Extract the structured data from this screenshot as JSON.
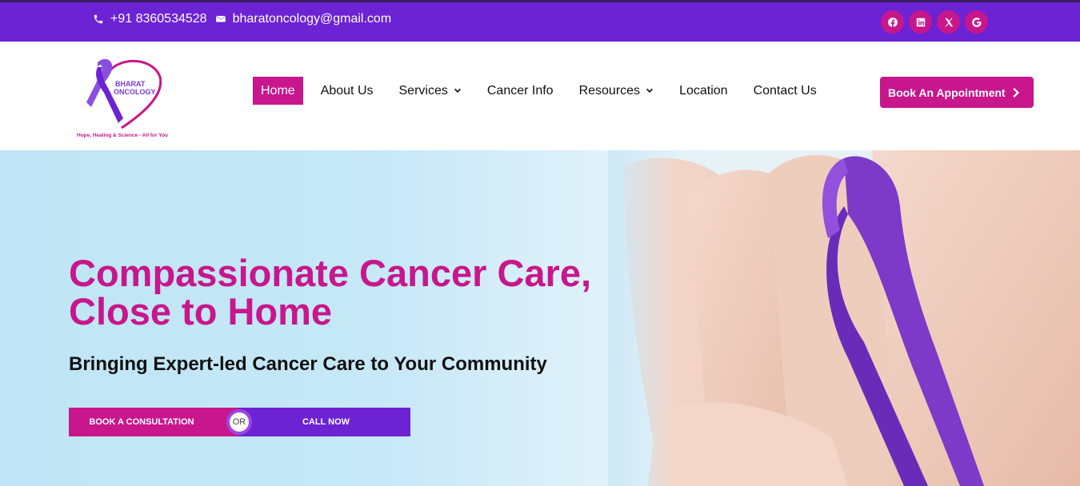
{
  "topbar": {
    "phone": "+91 8360534528",
    "email": "bharatoncology@gmail.com",
    "socials": [
      "facebook-icon",
      "linkedin-icon",
      "x-icon",
      "google-icon"
    ]
  },
  "logo": {
    "line1": "BHARAT",
    "line2": "ONCOLOGY",
    "tagline": "Hope, Healing & Science - All for You"
  },
  "nav": {
    "items": [
      {
        "label": "Home",
        "active": true
      },
      {
        "label": "About Us"
      },
      {
        "label": "Services",
        "dropdown": true
      },
      {
        "label": "Cancer Info"
      },
      {
        "label": "Resources",
        "dropdown": true
      },
      {
        "label": "Location"
      },
      {
        "label": "Contact Us"
      }
    ]
  },
  "header": {
    "book_label": "Book An Appointment"
  },
  "hero": {
    "title_line1": "Compassionate Cancer Care,",
    "title_line2": "Close to Home",
    "subtitle": "Bringing Expert-led Cancer Care to Your Community",
    "cta_left": "BOOK A CONSULTATION",
    "cta_or": "OR",
    "cta_right": "CALL NOW"
  },
  "colors": {
    "purple": "#6b23d4",
    "magenta": "#c8168c",
    "hero_bg": "#bfe5f6"
  }
}
